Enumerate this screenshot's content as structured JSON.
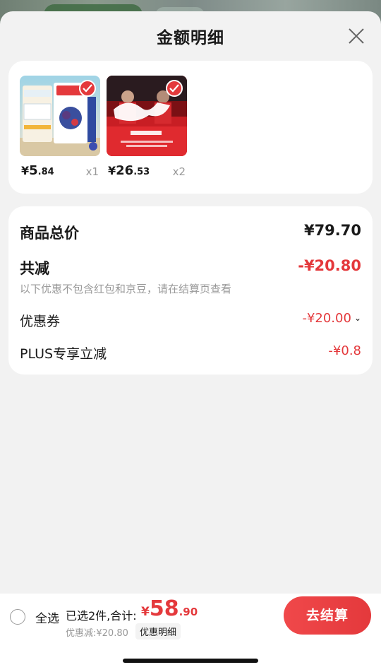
{
  "header": {
    "title": "金额明细"
  },
  "products": [
    {
      "currency": "¥",
      "price_int": "5",
      "price_dec": ".84",
      "qty": "x1",
      "thumb": "milk-tea"
    },
    {
      "currency": "¥",
      "price_int": "26",
      "price_dec": ".53",
      "qty": "x2",
      "thumb": "coca-cola"
    }
  ],
  "summary": {
    "total_label": "商品总价",
    "total_value": "¥79.70",
    "reduce_label": "共减",
    "reduce_value": "-¥20.80",
    "reduce_note": "以下优惠不包含红包和京豆，请在结算页查看",
    "coupon_label": "优惠券",
    "coupon_value": "-¥20.00",
    "plus_label": "PLUS专享立减",
    "plus_value": "-¥0.8"
  },
  "bottom": {
    "select_all": "全选",
    "selected_text": "已选2件,合计:",
    "total_currency": "¥",
    "total_int": "58",
    "total_dec": ".90",
    "discount_text": "优惠减:¥20.80",
    "detail_label": "优惠明细",
    "checkout_label": "去结算"
  },
  "colors": {
    "accent": "#e4393c"
  }
}
